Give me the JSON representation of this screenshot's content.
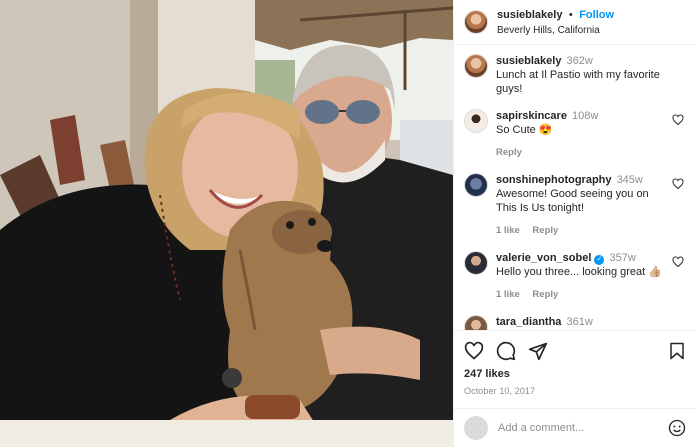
{
  "post": {
    "username": "susieblakely",
    "separator": "•",
    "follow_label": "Follow",
    "location": "Beverly Hills, California"
  },
  "comments": [
    {
      "user": "susieblakely",
      "age": "362w",
      "text": "Lunch at Il Pastio with my favorite guys!",
      "meta": []
    },
    {
      "user": "sapirskincare",
      "age": "108w",
      "text": "So Cute 😍",
      "meta": [
        "Reply"
      ]
    },
    {
      "user": "sonshinephotography",
      "age": "345w",
      "text": "Awesome! Good seeing you on This Is Us tonight!",
      "meta": [
        "1 like",
        "Reply"
      ]
    },
    {
      "user": "valerie_von_sobel",
      "age": "357w",
      "text": "Hello you three... looking great 👍🏼",
      "meta": [
        "1 like",
        "Reply"
      ],
      "verified": true
    },
    {
      "user": "tara_diantha",
      "age": "361w",
      "text": "",
      "meta": []
    }
  ],
  "actions": {
    "likes": "247 likes",
    "date": "October 10, 2017"
  },
  "add_comment": {
    "placeholder": "Add a comment..."
  },
  "icons": {
    "like": "heart-icon",
    "comment": "comment-bubble-icon",
    "share": "paper-plane-icon",
    "save": "bookmark-icon",
    "emoji": "smiley-icon",
    "comment_like": "small-heart-icon"
  },
  "colors": {
    "accent": "#0095f6",
    "muted": "#8e8e8e",
    "text": "#262626"
  }
}
